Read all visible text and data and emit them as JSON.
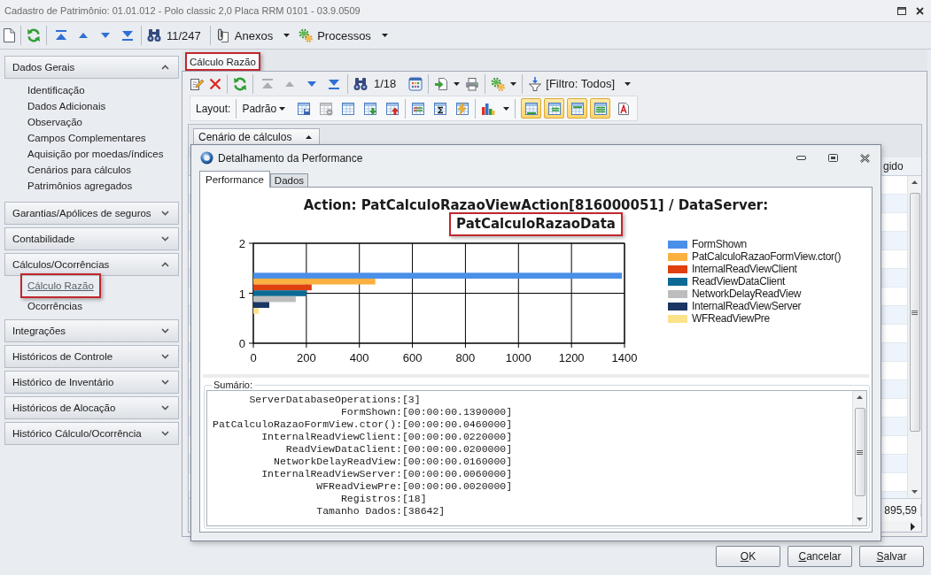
{
  "window": {
    "title": "Cadastro de Patrimônio: 01.01.012 - Polo classic 2,0 Placa RRM 0101 - 03.9.0509"
  },
  "toolbar": {
    "navigation": [
      {
        "kind": "first",
        "disabled": false
      },
      {
        "kind": "previous",
        "disabled": false
      },
      {
        "kind": "next",
        "disabled": false
      },
      {
        "kind": "last",
        "disabled": false
      }
    ],
    "record_counter": "11/247",
    "menus": [
      {
        "kind": "attachments",
        "label": "Anexos"
      },
      {
        "kind": "processes",
        "label": "Processos"
      }
    ]
  },
  "sidebar": {
    "groups": [
      {
        "label": "Dados Gerais",
        "expanded": true,
        "items": [
          {
            "label": "Identificação",
            "selected": false,
            "highlighted": false
          },
          {
            "label": "Dados Adicionais",
            "selected": false,
            "highlighted": false
          },
          {
            "label": "Observação",
            "selected": false,
            "highlighted": false
          },
          {
            "label": "Campos Complementares",
            "selected": false,
            "highlighted": false
          },
          {
            "label": "Aquisição por moedas/índices",
            "selected": false,
            "highlighted": false
          },
          {
            "label": "Cenários para cálculos",
            "selected": false,
            "highlighted": false
          },
          {
            "label": "Patrimônios agregados",
            "selected": false,
            "highlighted": false
          }
        ]
      },
      {
        "label": "Garantias/Apólices de seguros",
        "expanded": false
      },
      {
        "label": "Contabilidade",
        "expanded": false
      },
      {
        "label": "Cálculos/Ocorrências",
        "expanded": true,
        "items": [
          {
            "label": "Cálculo Razão",
            "selected": true,
            "highlighted": true
          },
          {
            "label": "Ocorrências",
            "selected": false,
            "highlighted": false
          }
        ]
      },
      {
        "label": "Integrações",
        "expanded": false
      },
      {
        "label": "Históricos de Controle",
        "expanded": false
      },
      {
        "label": "Histórico de Inventário",
        "expanded": false
      },
      {
        "label": "Históricos de Alocação",
        "expanded": false
      },
      {
        "label": "Histórico Cálculo/Ocorrência",
        "expanded": false
      }
    ]
  },
  "panel": {
    "tabs": [
      {
        "label": "Cálculo Razão",
        "selected": true,
        "highlighted": true
      }
    ],
    "toolbar": {
      "navigation": [
        {
          "kind": "first",
          "disabled": true
        },
        {
          "kind": "previous",
          "disabled": true
        },
        {
          "kind": "next",
          "disabled": false
        },
        {
          "kind": "last",
          "disabled": false
        }
      ],
      "record_counter": "1/18",
      "filter": "[Filtro: Todos]"
    },
    "layout_bar": {
      "label": "Layout:",
      "preset": "Padrão",
      "tools": [
        {
          "kind": "save",
          "disabled": false
        },
        {
          "kind": "remove",
          "disabled": true
        },
        {
          "kind": "plain",
          "disabled": false
        },
        {
          "kind": "import",
          "disabled": false
        },
        {
          "kind": "export",
          "disabled": false
        },
        {
          "kind": "lines",
          "disabled": false
        },
        {
          "kind": "sum",
          "disabled": false
        },
        {
          "kind": "flash",
          "disabled": false
        }
      ],
      "view_toggles": [
        {
          "kind": "footer",
          "on": true
        },
        {
          "kind": "group-footer",
          "on": true
        },
        {
          "kind": "header",
          "on": true
        },
        {
          "kind": "rows",
          "on": true
        },
        {
          "kind": "font",
          "on": false
        }
      ]
    },
    "grid": {
      "group_by": "Cenário de cálculos",
      "column_headers": [
        "gido"
      ],
      "totals": [
        "895,59"
      ]
    }
  },
  "dialog": {
    "title": "Detalhamento da Performance",
    "tabs": [
      {
        "label": "Performance",
        "selected": true
      },
      {
        "label": "Dados",
        "selected": false
      }
    ],
    "chart_heading": [
      {
        "text": "Action: PatCalculoRazaoViewAction[816000051] / DataServer:",
        "highlighted": false
      },
      {
        "text": "PatCalculoRazaoData",
        "highlighted": true
      }
    ],
    "chart_data": {
      "type": "bar",
      "orientation": "horizontal",
      "categories": [
        "2",
        "1",
        "0"
      ],
      "series": [
        {
          "name": "FormShown",
          "color": "#4a8fe8",
          "values": [
            null,
            1390,
            null
          ]
        },
        {
          "name": "PatCalculoRazaoFormView.ctor()",
          "color": "#fbb040",
          "values": [
            null,
            460,
            null
          ]
        },
        {
          "name": "InternalReadViewClient",
          "color": "#e04010",
          "values": [
            null,
            220,
            null
          ]
        },
        {
          "name": "ReadViewDataClient",
          "color": "#0d6a94",
          "values": [
            null,
            200,
            null
          ]
        },
        {
          "name": "NetworkDelayReadView",
          "color": "#bdbdbd",
          "values": [
            null,
            160,
            null
          ]
        },
        {
          "name": "InternalReadViewServer",
          "color": "#1c3664",
          "values": [
            null,
            60,
            null
          ]
        },
        {
          "name": "WFReadViewPre",
          "color": "#fde28c",
          "values": [
            null,
            20,
            null
          ]
        }
      ],
      "xlim": [
        0,
        1400
      ],
      "xticks": [
        0,
        200,
        400,
        600,
        800,
        1000,
        1200,
        1400
      ],
      "grid": true,
      "legend": true
    },
    "summary": {
      "label": "Sumário:",
      "lines": [
        {
          "label": "ServerDatabaseOperations:",
          "value": "[3]"
        },
        {
          "label": "FormShown:",
          "value": "[00:00:00.1390000]"
        },
        {
          "label": "PatCalculoRazaoFormView.ctor():",
          "value": "[00:00:00.0460000]"
        },
        {
          "label": "InternalReadViewClient:",
          "value": "[00:00:00.0220000]"
        },
        {
          "label": "ReadViewDataClient:",
          "value": "[00:00:00.0200000]"
        },
        {
          "label": "NetworkDelayReadView:",
          "value": "[00:00:00.0160000]"
        },
        {
          "label": "InternalReadViewServer:",
          "value": "[00:00:00.0060000]"
        },
        {
          "label": "WFReadViewPre:",
          "value": "[00:00:00.0020000]"
        },
        {
          "label": "Registros:",
          "value": "[18]"
        },
        {
          "label": "Tamanho Dados:",
          "value": "[38642]"
        }
      ]
    }
  },
  "buttons": [
    {
      "label": "OK",
      "mnemonic": true
    },
    {
      "label": "Cancelar",
      "mnemonic": true
    },
    {
      "label": "Salvar",
      "mnemonic": true
    }
  ]
}
